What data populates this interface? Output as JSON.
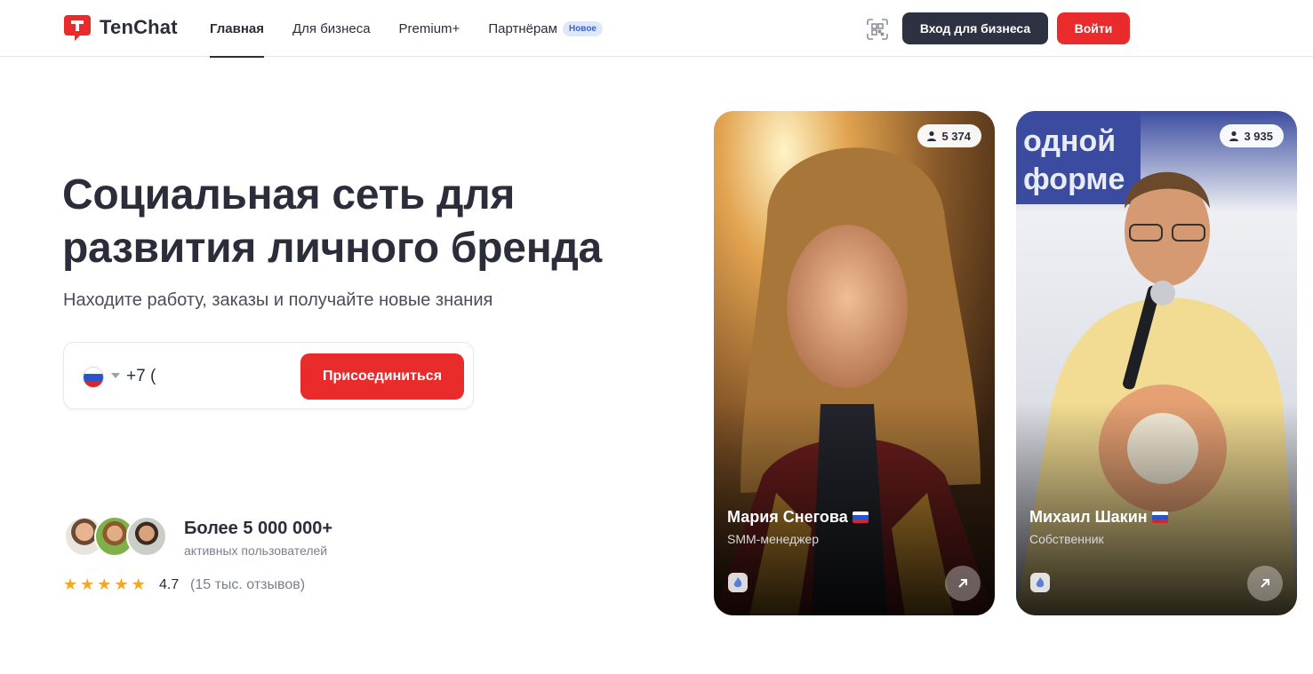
{
  "header": {
    "logo_text": "TenChat",
    "nav": [
      {
        "label": "Главная",
        "active": true
      },
      {
        "label": "Для бизнеса",
        "active": false
      },
      {
        "label": "Premium+",
        "active": false
      },
      {
        "label": "Партнёрам",
        "active": false,
        "badge": "Новое"
      }
    ],
    "qr_icon": "qr-code-icon",
    "business_login_label": "Вход для бизнеса",
    "login_label": "Войти"
  },
  "hero": {
    "title_line1": "Социальная сеть для",
    "title_line2": "развития личного бренда",
    "subtitle": "Находите работу, заказы и получайте новые знания",
    "phone": {
      "country_flag": "ru-flag-icon",
      "value": "+7 ("
    },
    "join_label": "Присоединиться"
  },
  "social_proof": {
    "users_count": "Более 5 000 000+",
    "users_caption": "активных пользователей",
    "stars": 5,
    "rating": "4.7",
    "reviews": "(15 тыс. отзывов)"
  },
  "cards": [
    {
      "followers": "5 374",
      "name": "Мария Снегова",
      "role": "SMM-менеджер"
    },
    {
      "followers": "3 935",
      "name": "Михаил Шакин",
      "role": "Собственник"
    }
  ],
  "colors": {
    "accent_red": "#ea2b2b",
    "dark_button": "#2e3142",
    "text_dark": "#2b2e3a",
    "badge_blue": "#3d63c9",
    "star_orange": "#f5a623"
  }
}
